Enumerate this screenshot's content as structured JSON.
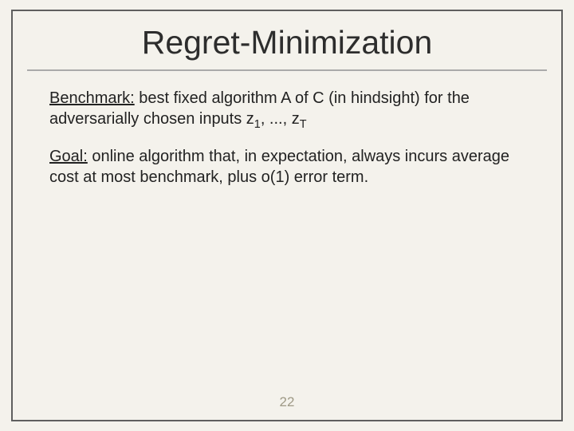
{
  "slide": {
    "title": "Regret-Minimization",
    "benchmark_label": "Benchmark:",
    "benchmark_text_1": " best fixed algorithm A of C (in hindsight) for the adversarially chosen inputs z",
    "benchmark_sub1": "1",
    "benchmark_text_2": ", ..., z",
    "benchmark_subT": "T",
    "goal_label": "Goal:",
    "goal_text": " online algorithm that, in expectation, always incurs average cost at most benchmark, plus o(1) error term.",
    "page_number": "22"
  }
}
